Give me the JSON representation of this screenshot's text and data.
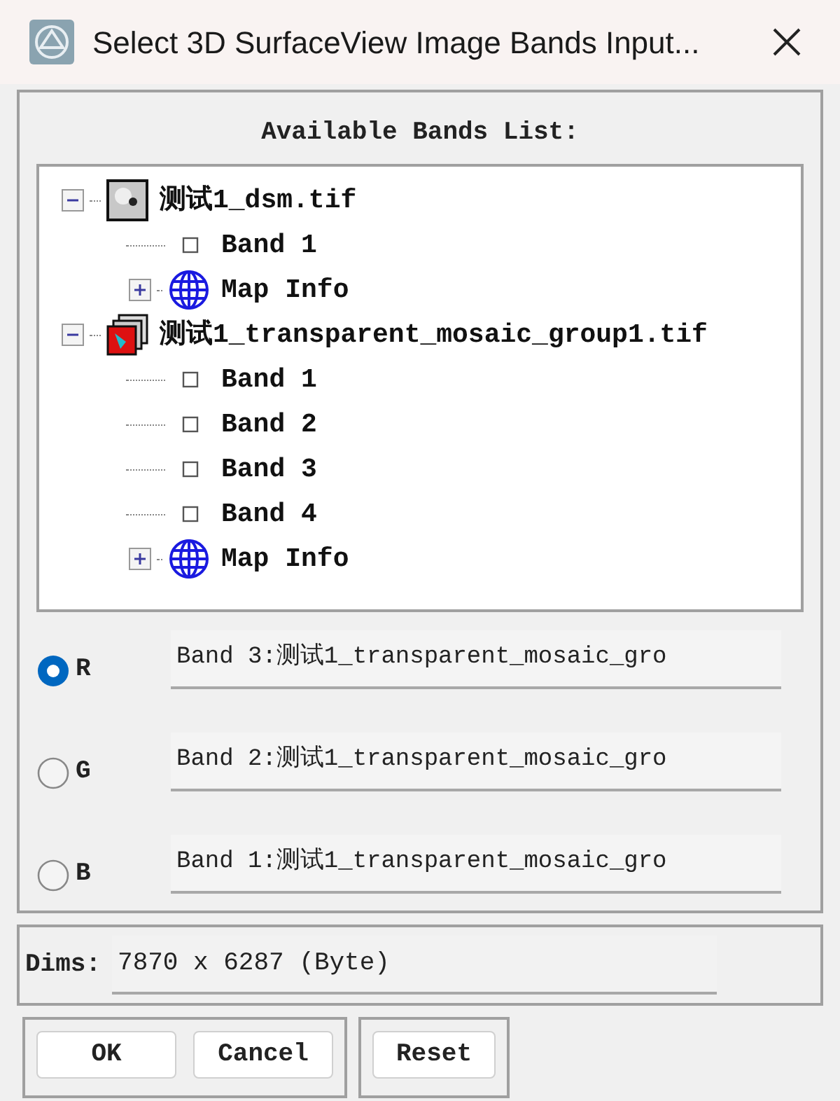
{
  "window": {
    "title": "Select 3D SurfaceView Image Bands Input..."
  },
  "bands_list": {
    "label": "Available Bands List:",
    "items": [
      {
        "kind": "file",
        "label": "测试1_dsm.tif",
        "expanded": true,
        "children": [
          {
            "kind": "band",
            "label": "Band 1"
          },
          {
            "kind": "mapinfo",
            "label": "Map Info",
            "expanded": false
          }
        ]
      },
      {
        "kind": "file",
        "label": "测试1_transparent_mosaic_group1.tif",
        "expanded": true,
        "children": [
          {
            "kind": "band",
            "label": "Band 1"
          },
          {
            "kind": "band",
            "label": "Band 2"
          },
          {
            "kind": "band",
            "label": "Band 3"
          },
          {
            "kind": "band",
            "label": "Band 4"
          },
          {
            "kind": "mapinfo",
            "label": "Map Info",
            "expanded": false
          }
        ]
      }
    ]
  },
  "channels": [
    {
      "label": "R",
      "selected": true,
      "value": "Band 3:测试1_transparent_mosaic_gro"
    },
    {
      "label": "G",
      "selected": false,
      "value": "Band 2:测试1_transparent_mosaic_gro"
    },
    {
      "label": "B",
      "selected": false,
      "value": "Band 1:测试1_transparent_mosaic_gro"
    }
  ],
  "dims": {
    "label": "Dims:",
    "value": "7870 x 6287 (Byte)"
  },
  "buttons": [
    "OK",
    "Cancel"
  ],
  "reset_button": "Reset"
}
